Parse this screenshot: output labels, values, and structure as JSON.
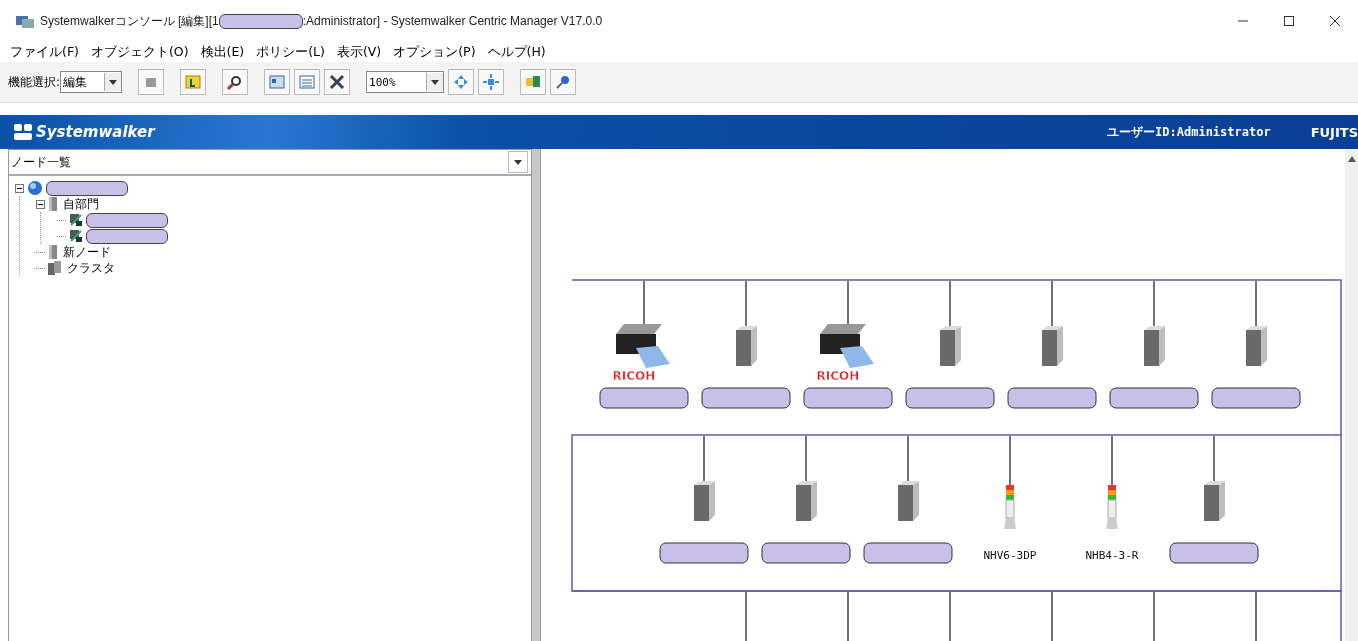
{
  "window": {
    "title_start": "Systemwalkerコンソール [編集][1",
    "title_end": ":Administrator] - Systemwalker Centric Manager V17.0.0"
  },
  "menu": [
    {
      "label": "ファイル(F)"
    },
    {
      "label": "オブジェクト(O)"
    },
    {
      "label": "検出(E)"
    },
    {
      "label": "ポリシー(L)"
    },
    {
      "label": "表示(V)"
    },
    {
      "label": "オプション(P)"
    },
    {
      "label": "ヘルプ(H)"
    }
  ],
  "toolbar": {
    "mode_label": "機能選択:",
    "mode_value": "編集",
    "zoom_value": "100%"
  },
  "header": {
    "logo": "Systemwalker",
    "user": "ユーザーID:Administrator",
    "brand": "FUJITS"
  },
  "tree_panel": {
    "view_select": "ノード一覧",
    "tree": [
      {
        "kind": "network",
        "redacted": true,
        "expanded": true,
        "children": [
          {
            "kind": "folder",
            "label": "自部門",
            "expanded": true,
            "children": [
              {
                "kind": "host",
                "redacted": true
              },
              {
                "kind": "host",
                "redacted": true
              }
            ]
          },
          {
            "kind": "folder",
            "label": "新ノード"
          },
          {
            "kind": "cluster",
            "label": "クラスタ"
          }
        ]
      }
    ]
  },
  "map": {
    "segments": [
      {
        "nodes": [
          {
            "kind": "printer",
            "label": "RICOH",
            "redacted_address": true
          },
          {
            "kind": "server",
            "redacted_address": true
          },
          {
            "kind": "printer",
            "label": "RICOH",
            "redacted_address": true
          },
          {
            "kind": "server",
            "redacted_address": true
          },
          {
            "kind": "server",
            "redacted_address": true
          },
          {
            "kind": "server",
            "redacted_address": true
          },
          {
            "kind": "server",
            "redacted_address": true
          }
        ]
      },
      {
        "nodes": [
          {
            "kind": "server",
            "redacted_address": true
          },
          {
            "kind": "server",
            "redacted_address": true
          },
          {
            "kind": "server",
            "redacted_address": true
          },
          {
            "kind": "signal",
            "label": "NHV6-3DP",
            "redacted_address": false
          },
          {
            "kind": "signal",
            "label": "NHB4-3-R",
            "redacted_address": false
          },
          {
            "kind": "server",
            "redacted_address": true
          }
        ]
      },
      {
        "nodes": [
          {
            "kind": "hidden"
          },
          {
            "kind": "hidden"
          },
          {
            "kind": "hidden"
          },
          {
            "kind": "hidden"
          },
          {
            "kind": "hidden"
          },
          {
            "kind": "hidden"
          }
        ]
      }
    ]
  }
}
